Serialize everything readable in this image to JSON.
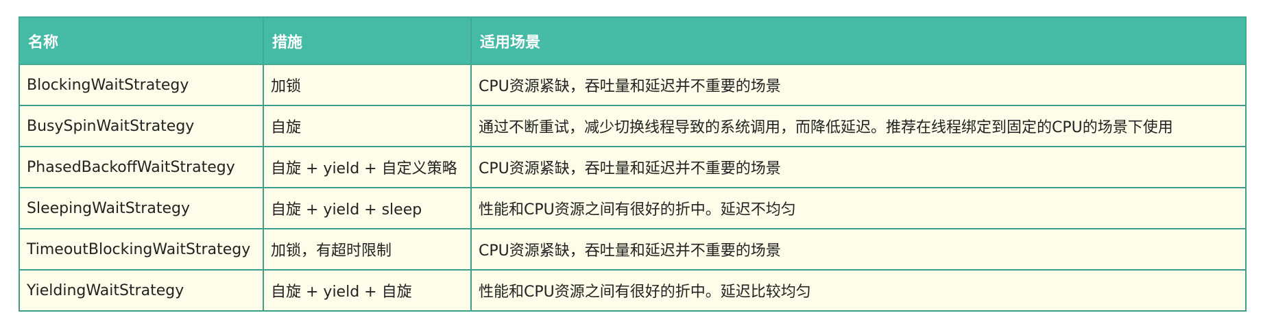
{
  "table": {
    "headers": [
      "名称",
      "措施",
      "适用场景"
    ],
    "rows": [
      [
        "BlockingWaitStrategy",
        "加锁",
        "CPU资源紧缺，吞吐量和延迟并不重要的场景"
      ],
      [
        "BusySpinWaitStrategy",
        "自旋",
        "通过不断重试，减少切换线程导致的系统调用，而降低延迟。推荐在线程绑定到固定的CPU的场景下使用"
      ],
      [
        "PhasedBackoffWaitStrategy",
        "自旋 + yield + 自定义策略",
        "CPU资源紧缺，吞吐量和延迟并不重要的场景"
      ],
      [
        "SleepingWaitStrategy",
        "自旋 + yield + sleep",
        "性能和CPU资源之间有很好的折中。延迟不均匀"
      ],
      [
        "TimeoutBlockingWaitStrategy",
        "加锁，有超时限制",
        "CPU资源紧缺，吞吐量和延迟并不重要的场景"
      ],
      [
        "YieldingWaitStrategy",
        "自旋 + yield + 自旋",
        "性能和CPU资源之间有很好的折中。延迟比较均匀"
      ]
    ]
  },
  "colors": {
    "header_bg": "#45bba6",
    "row_bg": "#fdfde9",
    "border": "#3e9e89"
  }
}
